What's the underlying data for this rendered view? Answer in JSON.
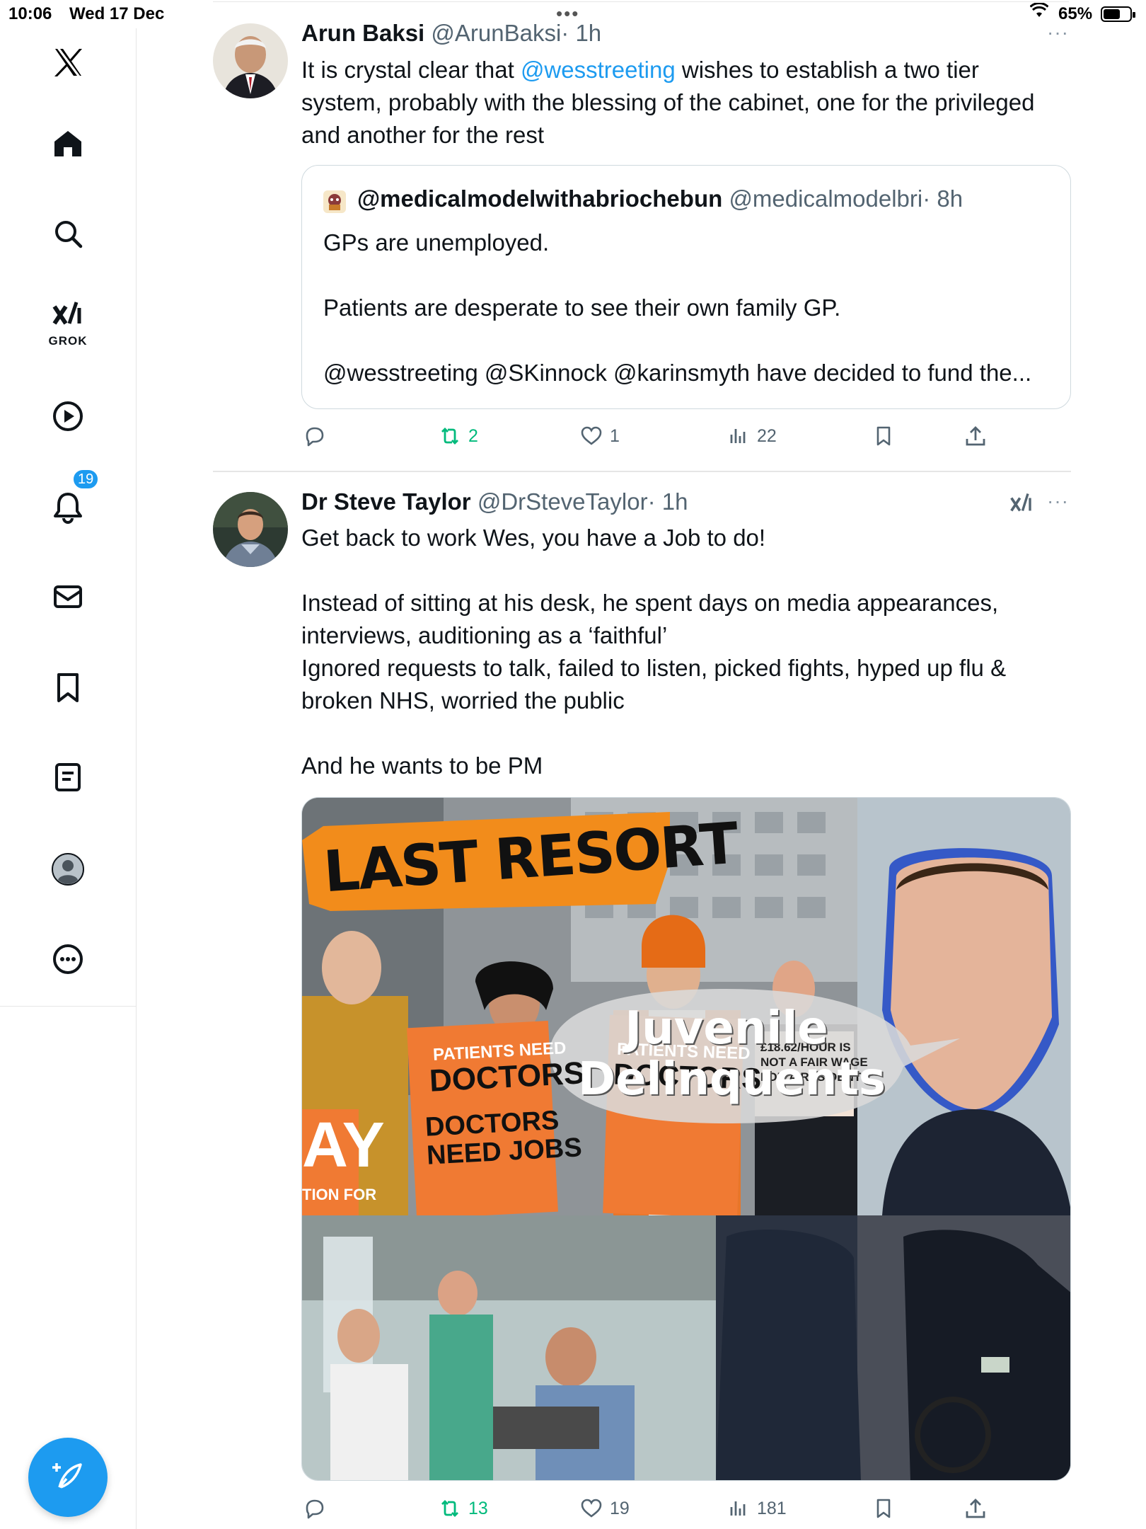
{
  "status_bar": {
    "time": "10:06",
    "date": "Wed 17 Dec",
    "battery": "65%",
    "battery_level": 0.65
  },
  "sidebar": {
    "items": [
      {
        "name": "x-logo-icon"
      },
      {
        "name": "home-icon"
      },
      {
        "name": "search-icon"
      },
      {
        "name": "grok-icon",
        "label": "GROK"
      },
      {
        "name": "play-icon"
      },
      {
        "name": "notifications-icon",
        "badge": "19"
      },
      {
        "name": "mail-icon"
      },
      {
        "name": "bookmark-icon"
      },
      {
        "name": "lists-icon"
      },
      {
        "name": "profile-icon"
      },
      {
        "name": "more-icon"
      }
    ],
    "compose": "compose-icon"
  },
  "tweets": [
    {
      "author": "Arun Baksi",
      "handle": "@ArunBaksi",
      "time": "· 1h",
      "text_before": "It is crystal clear that ",
      "mention": "@wesstreeting",
      "text_after": " wishes to establish a two tier\nsystem, probably with the blessing of the cabinet, one for the privileged\nand another for the rest",
      "quote": {
        "author": "@medicalmodelwithabriochebun",
        "handle": "@medicalmodelbri",
        "time": "· 8h",
        "text": "GPs are unemployed.\n\nPatients are desperate to see their own family GP.\n\n@wesstreeting @SKinnock @karinsmyth have decided to fund the..."
      },
      "stats": {
        "replies": "",
        "reposts": "2",
        "likes": "1",
        "views": "22"
      }
    },
    {
      "author": "Dr Steve Taylor",
      "handle": "@DrSteveTaylor",
      "time": "· 1h",
      "text": "Get back to work Wes, you have a Job to do!\n\nInstead of sitting at his desk, he spent days on media appearances,\ninterviews, auditioning as a ‘faithful’\nIgnored requests to talk, failed to listen, picked fights, hyped up flu &\nbroken NHS, worried the public\n\nAnd he wants to be PM",
      "media": {
        "banner": "LAST RESORT",
        "sign1_top": "PATIENTS NEED",
        "sign1_big": "DOCTORS",
        "sign1_sub": "DOCTORS\nNEED JOBS",
        "sign2_top": "PATIENTS NEED",
        "sign2_big": "DOCTORS",
        "sign3": "£18.62/HOUR IS\nNOT A FAIR WAGE\nFOR A RESIDENT",
        "left_sign": "AY",
        "left_sign_sub": "TION FOR",
        "bubble": "Juvenile\nDelinquents"
      },
      "stats": {
        "replies": "",
        "reposts": "13",
        "likes": "19",
        "views": "181"
      }
    }
  ],
  "colors": {
    "accent": "#1d9bf0",
    "repost": "#00ba7c",
    "muted": "#536471"
  }
}
